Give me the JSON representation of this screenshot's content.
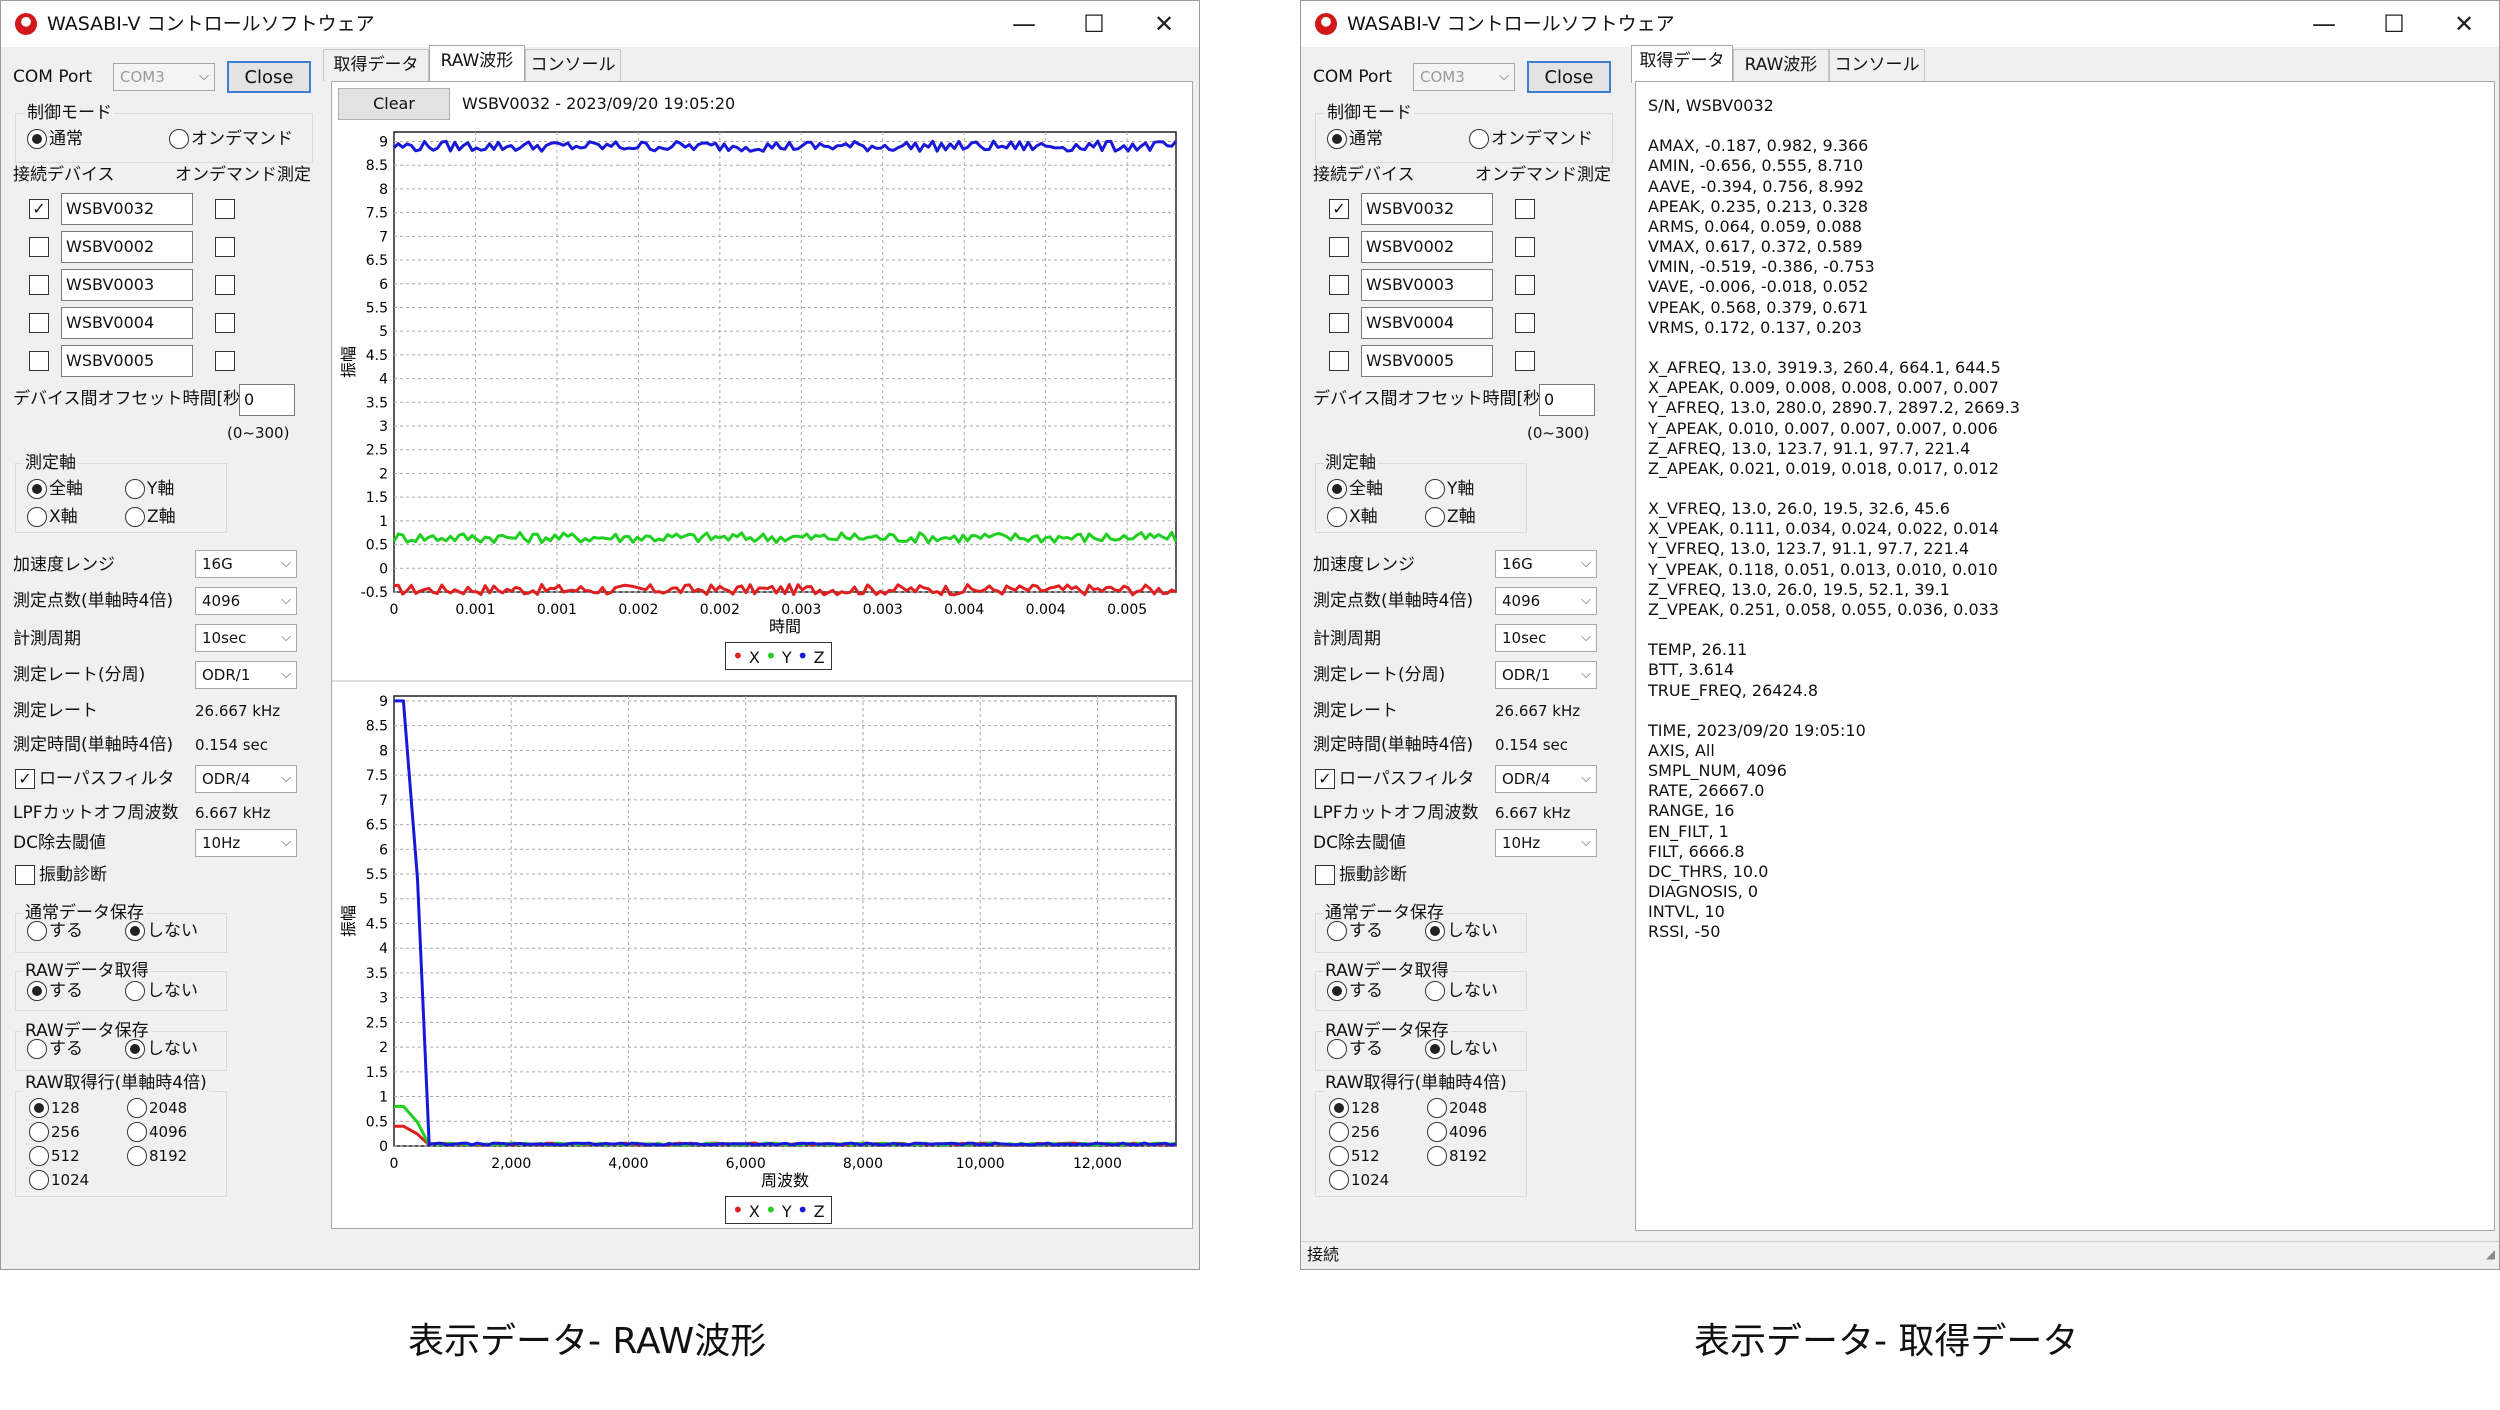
{
  "app": {
    "title": "WASABI-V コントロールソフトウェア",
    "minimize": "—",
    "maximize": "☐",
    "close": "✕"
  },
  "left": {
    "com_port_label": "COM Port",
    "com_port_value": "COM3",
    "close_button": "Close",
    "control_mode_label": "制御モード",
    "mode_normal": "通常",
    "mode_ondemand": "オンデマンド",
    "connected_devices_label": "接続デバイス",
    "ondemand_measure_label": "オンデマンド測定",
    "devices": [
      "WSBV0032",
      "WSBV0002",
      "WSBV0003",
      "WSBV0004",
      "WSBV0005"
    ],
    "offset_label": "デバイス間オフセット時間[秒]",
    "offset_value": "0",
    "offset_range": "(0~300)",
    "axis_group_label": "測定軸",
    "axis_all": "全軸",
    "axis_y": "Y軸",
    "axis_x": "X軸",
    "axis_z": "Z軸",
    "accel_range_label": "加速度レンジ",
    "accel_range_value": "16G",
    "points_label": "測定点数(単軸時4倍)",
    "points_value": "4096",
    "period_label": "計測周期",
    "period_value": "10sec",
    "rate_div_label": "測定レート(分周)",
    "rate_div_value": "ODR/1",
    "rate_label": "測定レート",
    "rate_value": "26.667 kHz",
    "time_label": "測定時間(単軸時4倍)",
    "time_value": "0.154 sec",
    "lpf_label": "ローパスフィルタ",
    "lpf_value": "ODR/4",
    "lpf_cutoff_label": "LPFカットオフ周波数",
    "lpf_cutoff_value": "6.667 kHz",
    "dc_label": "DC除去閾値",
    "dc_value": "10Hz",
    "vib_diag_label": "振動診断",
    "normal_save_label": "通常データ保存",
    "yes": "する",
    "no": "しない",
    "raw_get_label": "RAWデータ取得",
    "raw_save_label": "RAWデータ保存",
    "raw_rows_label": "RAW取得行(単軸時4倍)",
    "raw_rows": [
      "128",
      "2048",
      "256",
      "4096",
      "512",
      "8192",
      "1024"
    ]
  },
  "tabs": [
    "取得データ",
    "RAW波形",
    "コンソール"
  ],
  "raw": {
    "clear_button": "Clear",
    "header_text": "WSBV0032 - 2023/09/20 19:05:20"
  },
  "chart_data": [
    {
      "type": "line",
      "xlabel": "時間",
      "ylabel": "振幅",
      "x_ticks": [
        "0",
        "0.001",
        "0.001",
        "0.002",
        "0.002",
        "0.003",
        "0.003",
        "0.004",
        "0.004",
        "0.005"
      ],
      "y_ticks": [
        "9",
        "8.5",
        "8",
        "7.5",
        "7",
        "6.5",
        "6",
        "5.5",
        "5",
        "4.5",
        "4",
        "3.5",
        "3",
        "2.5",
        "2",
        "1.5",
        "1",
        "0.5",
        "0",
        "-0.5"
      ],
      "ylim": [
        -0.5,
        9.2
      ],
      "xlim": [
        0,
        0.00548
      ],
      "grid": true,
      "legend": "bottom-center",
      "series": [
        {
          "name": "X",
          "color": "#e02020",
          "level": -0.45
        },
        {
          "name": "Y",
          "color": "#20d020",
          "level": 0.65
        },
        {
          "name": "Z",
          "color": "#1818d8",
          "level": 8.9
        }
      ]
    },
    {
      "type": "line",
      "xlabel": "周波数",
      "ylabel": "振幅",
      "x_ticks": [
        "0",
        "2,000",
        "4,000",
        "6,000",
        "8,000",
        "10,000",
        "12,000"
      ],
      "y_ticks": [
        "9",
        "8.5",
        "8",
        "7.5",
        "7",
        "6.5",
        "6",
        "5.5",
        "5",
        "4.5",
        "4",
        "3.5",
        "3",
        "2.5",
        "2",
        "1.5",
        "1",
        "0.5",
        "0"
      ],
      "ylim": [
        0,
        9.1
      ],
      "xlim": [
        0,
        13333
      ],
      "grid": true,
      "legend": "bottom-center",
      "series": [
        {
          "name": "X",
          "color": "#e02020",
          "peak": 0.4
        },
        {
          "name": "Y",
          "color": "#20d020",
          "peak": 0.8
        },
        {
          "name": "Z",
          "color": "#1818d8",
          "peak": 9.0
        }
      ]
    }
  ],
  "data_text": "S/N, WSBV0032\n\nAMAX, -0.187, 0.982, 9.366\nAMIN, -0.656, 0.555, 8.710\nAAVE, -0.394, 0.756, 8.992\nAPEAK, 0.235, 0.213, 0.328\nARMS, 0.064, 0.059, 0.088\nVMAX, 0.617, 0.372, 0.589\nVMIN, -0.519, -0.386, -0.753\nVAVE, -0.006, -0.018, 0.052\nVPEAK, 0.568, 0.379, 0.671\nVRMS, 0.172, 0.137, 0.203\n\nX_AFREQ, 13.0, 3919.3, 260.4, 664.1, 644.5\nX_APEAK, 0.009, 0.008, 0.008, 0.007, 0.007\nY_AFREQ, 13.0, 280.0, 2890.7, 2897.2, 2669.3\nY_APEAK, 0.010, 0.007, 0.007, 0.007, 0.006\nZ_AFREQ, 13.0, 123.7, 91.1, 97.7, 221.4\nZ_APEAK, 0.021, 0.019, 0.018, 0.017, 0.012\n\nX_VFREQ, 13.0, 26.0, 19.5, 32.6, 45.6\nX_VPEAK, 0.111, 0.034, 0.024, 0.022, 0.014\nY_VFREQ, 13.0, 123.7, 91.1, 97.7, 221.4\nY_VPEAK, 0.118, 0.051, 0.013, 0.010, 0.010\nZ_VFREQ, 13.0, 26.0, 19.5, 52.1, 39.1\nZ_VPEAK, 0.251, 0.058, 0.055, 0.036, 0.033\n\nTEMP, 26.11\nBTT, 3.614\nTRUE_FREQ, 26424.8\n\nTIME, 2023/09/20 19:05:10\nAXIS, All\nSMPL_NUM, 4096\nRATE, 26667.0\nRANGE, 16\nEN_FILT, 1\nFILT, 6666.8\nDC_THRS, 10.0\nDIAGNOSIS, 0\nINTVL, 10\nRSSI, -50",
  "status_text": "接続",
  "captions": {
    "left": "表示データ- RAW波形",
    "right": "表示データ- 取得データ"
  }
}
